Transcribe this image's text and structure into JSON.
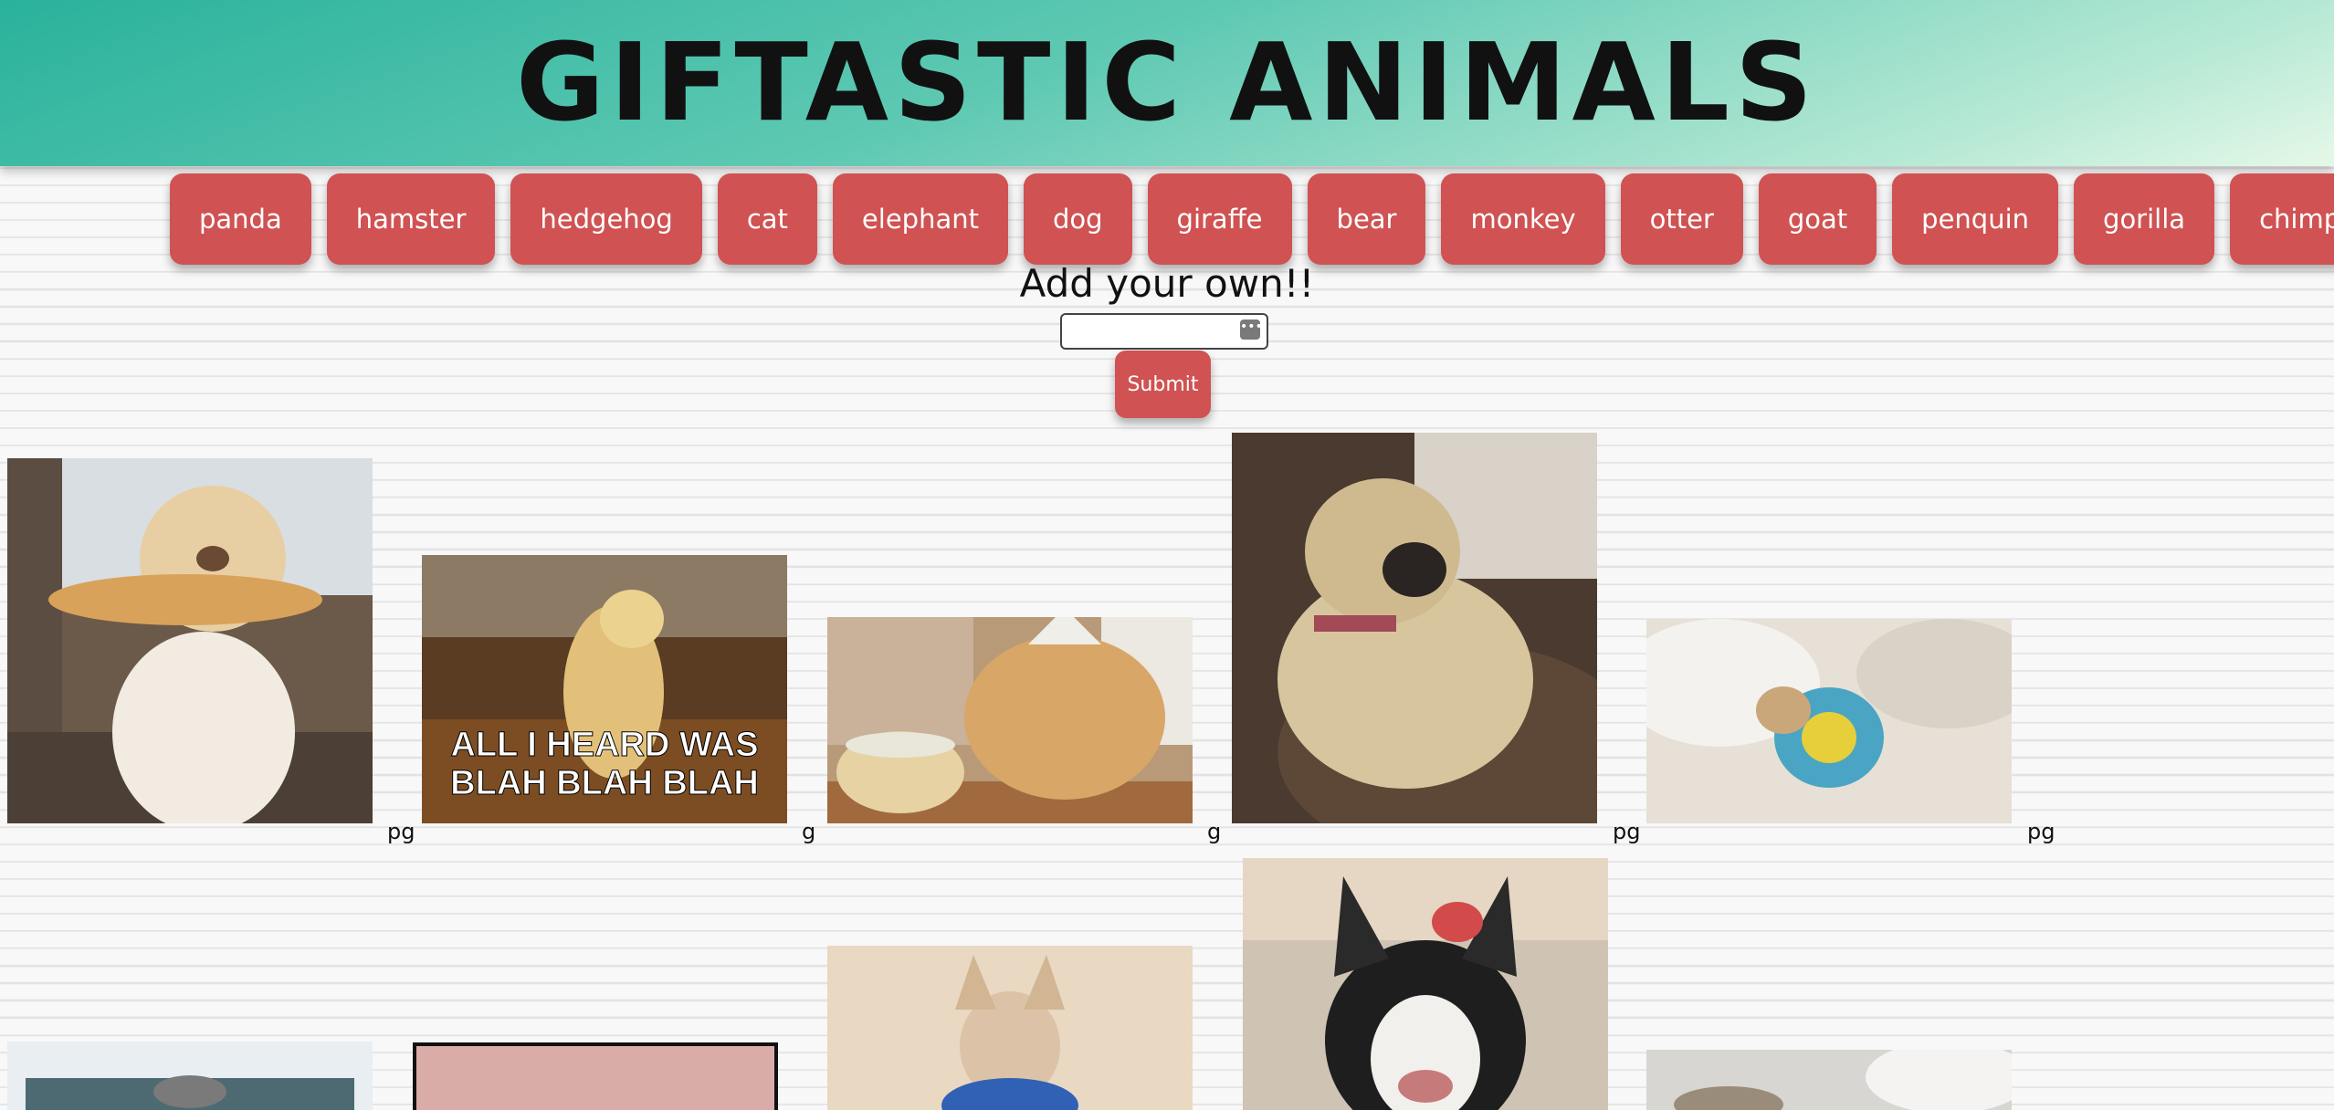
{
  "header": {
    "title": "GIFTASTIC ANIMALS"
  },
  "buttons": [
    "panda",
    "hamster",
    "hedgehog",
    "cat",
    "elephant",
    "dog",
    "giraffe",
    "bear",
    "monkey",
    "otter",
    "goat",
    "penquin",
    "gorilla",
    "chimpanzee"
  ],
  "add_form": {
    "label": "Add your own!!",
    "input_value": "",
    "submit_label": "Submit"
  },
  "results": {
    "row1": [
      {
        "rating": "pg",
        "subject": "dog holding hot dog"
      },
      {
        "rating": "g",
        "subject": "shiba inu dancing",
        "caption": "ALL I HEARD WAS BLAH BLAH BLAH"
      },
      {
        "rating": "g",
        "subject": "golden retriever with birthday cake"
      },
      {
        "rating": "pg",
        "subject": "pug on couch"
      },
      {
        "rating": "pg",
        "subject": "pug in pajamas on bed"
      }
    ],
    "row2": [
      {
        "subject": "cat on table"
      },
      {
        "subject": "pink frame"
      },
      {
        "subject": "chihuahua"
      },
      {
        "subject": "french bulldog"
      },
      {
        "subject": "cat in bed"
      }
    ]
  }
}
